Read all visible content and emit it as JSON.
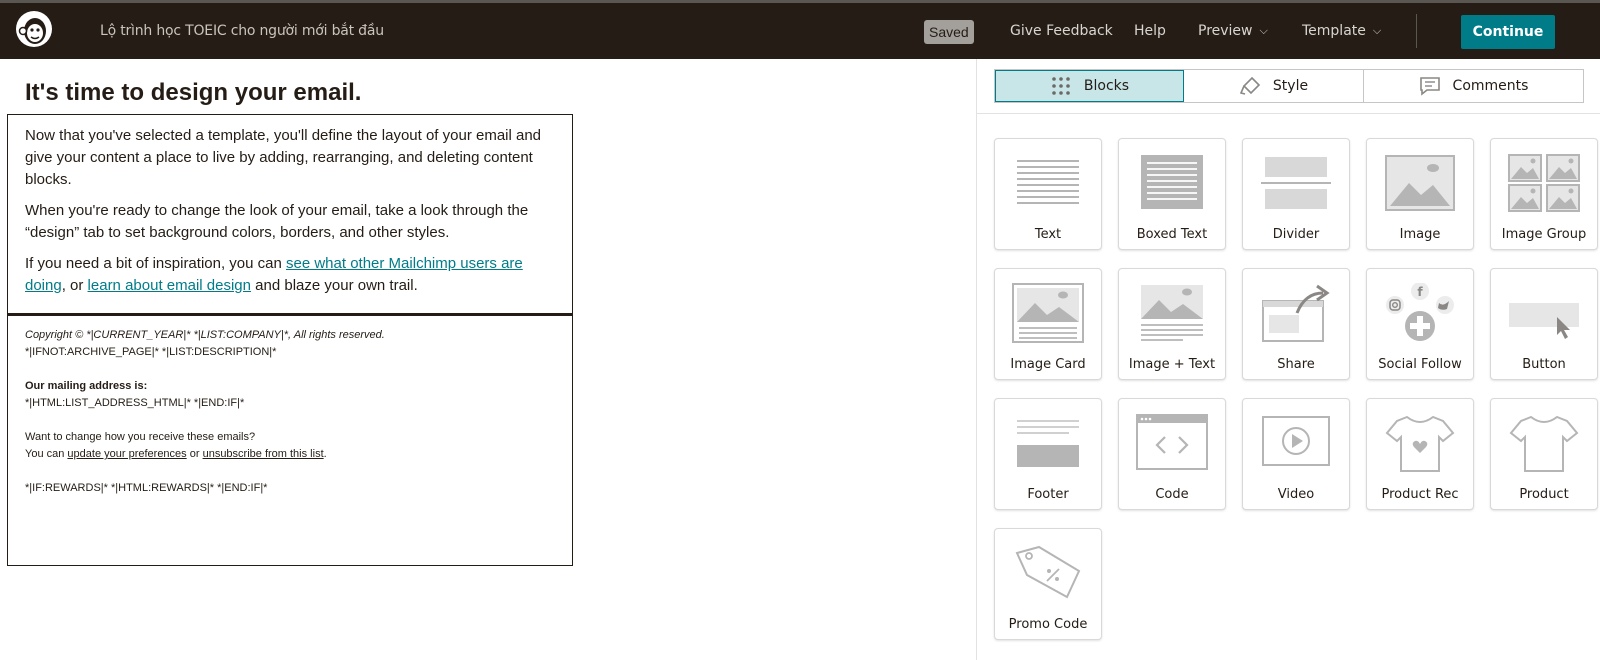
{
  "header": {
    "campaign_name": "Lộ trình học TOEIC cho người mới bắt đầu",
    "saved_label": "Saved",
    "nav": [
      "Give Feedback",
      "Help",
      "Preview",
      "Template"
    ],
    "continue_label": "Continue"
  },
  "main": {
    "title": "It's time to design your email.",
    "para1": "Now that you've selected a template, you'll define the layout of your email and give your content a place to live by adding, rearranging, and deleting content blocks.",
    "para2": "When you're ready to change the look of your email, take a look through the “design” tab to set background colors, borders, and other styles.",
    "para3_prefix": "If you need a bit of inspiration, you can ",
    "para3_link1": "see what other Mailchimp users are doing",
    "para3_middle": ", or ",
    "para3_link2": "learn about email design",
    "para3_suffix": " and blaze your own trail."
  },
  "footer": {
    "copyright": "Copyright © *|CURRENT_YEAR|* *|LIST:COMPANY|*, All rights reserved.",
    "archive_line": "*|IFNOT:ARCHIVE_PAGE|* *|LIST:DESCRIPTION|*",
    "address_heading": "Our mailing address is:",
    "address_line": "*|HTML:LIST_ADDRESS_HTML|* *|END:IF|*",
    "change_q": "Want to change how you receive these emails?",
    "you_can": "You can ",
    "update_link": "update your preferences",
    "or_text": " or ",
    "unsub_link": "unsubscribe from this list",
    "period": ".",
    "rewards_line": "*|IF:REWARDS|* *|HTML:REWARDS|* *|END:IF|*"
  },
  "sidebar": {
    "tabs": [
      "Blocks",
      "Style",
      "Comments"
    ],
    "active_tab": "Blocks",
    "blocks": [
      "Text",
      "Boxed Text",
      "Divider",
      "Image",
      "Image Group",
      "Image Card",
      "Image + Text",
      "Share",
      "Social Follow",
      "Button",
      "Footer",
      "Code",
      "Video",
      "Product Rec",
      "Product",
      "Promo Code"
    ]
  },
  "colors": {
    "topbar": "#241c15",
    "accent": "#007c89",
    "active_tab_bg": "#c8e6e8"
  }
}
